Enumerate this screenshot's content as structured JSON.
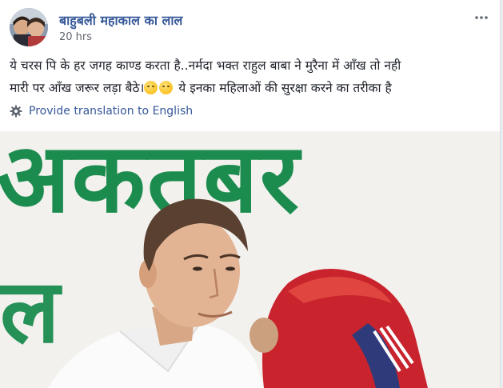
{
  "post": {
    "author_name": "बाहुबली महाकाल का लाल",
    "timestamp": "20 hrs",
    "text_line1": "ये चरस पि के हर जगह काण्ड करता है..नर्मदा भक्त राहुल बाबा ने मुरैना में आँख तो नही",
    "text_line2_a": "मारी पर आँख जरूर लड़ा बैठे।",
    "text_line2_b": " ये इनका महिलाओं की सुरक्षा करने का तरीका है",
    "translate_link": "Provide translation to English"
  },
  "photo": {
    "banner_text_top": "अकतूबर",
    "banner_text_bottom": "ल"
  },
  "icons": {
    "more": "ellipsis-icon",
    "translate": "gear-icon",
    "emoji": "smiling-face-icon"
  },
  "colors": {
    "link": "#365899",
    "banner_green": "#1c8c4e"
  }
}
